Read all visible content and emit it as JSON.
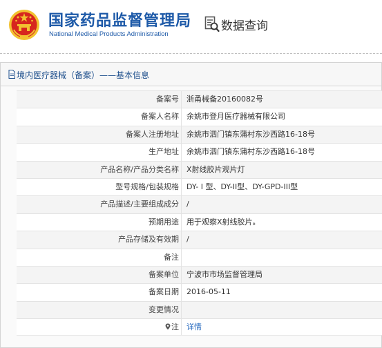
{
  "header": {
    "org_name_cn": "国家药品监督管理局",
    "org_name_en": "National Medical Products Administration",
    "query_label": "数据查询"
  },
  "panel": {
    "title": "境内医疗器械（备案）——基本信息"
  },
  "record": {
    "rows": [
      {
        "label": "备案号",
        "value": "浙甬械备20160082号"
      },
      {
        "label": "备案人名称",
        "value": "余姚市登月医疗器械有限公司"
      },
      {
        "label": "备案人注册地址",
        "value": "余姚市泗门镇东蒲村东沙西路16-18号"
      },
      {
        "label": "生产地址",
        "value": "余姚市泗门镇东蒲村东沙西路16-18号"
      },
      {
        "label": "产品名称/产品分类名称",
        "value": "X射线胶片观片灯"
      },
      {
        "label": "型号规格/包装规格",
        "value": "DY- I 型、DY-II型、DY-GPD-III型"
      },
      {
        "label": "产品描述/主要组成成分",
        "value": "/"
      },
      {
        "label": "预期用途",
        "value": "用于观察X射线胶片。"
      },
      {
        "label": "产品存储及有效期",
        "value": "/"
      },
      {
        "label": "备注",
        "value": ""
      },
      {
        "label": "备案单位",
        "value": "宁波市市场监督管理局"
      },
      {
        "label": "备案日期",
        "value": "2016-05-11"
      },
      {
        "label": "变更情况",
        "value": ""
      },
      {
        "label": "注",
        "value": "详情"
      }
    ]
  },
  "icons": {
    "emblem": "national-emblem-icon",
    "query": "document-search-icon",
    "panel_title": "document-icon",
    "note_pin": "location-pin-icon"
  },
  "colors": {
    "brand_blue": "#1e5aa8",
    "link_blue": "#2a6cc0",
    "emblem_red": "#d7261e",
    "emblem_gold": "#f2c230"
  }
}
